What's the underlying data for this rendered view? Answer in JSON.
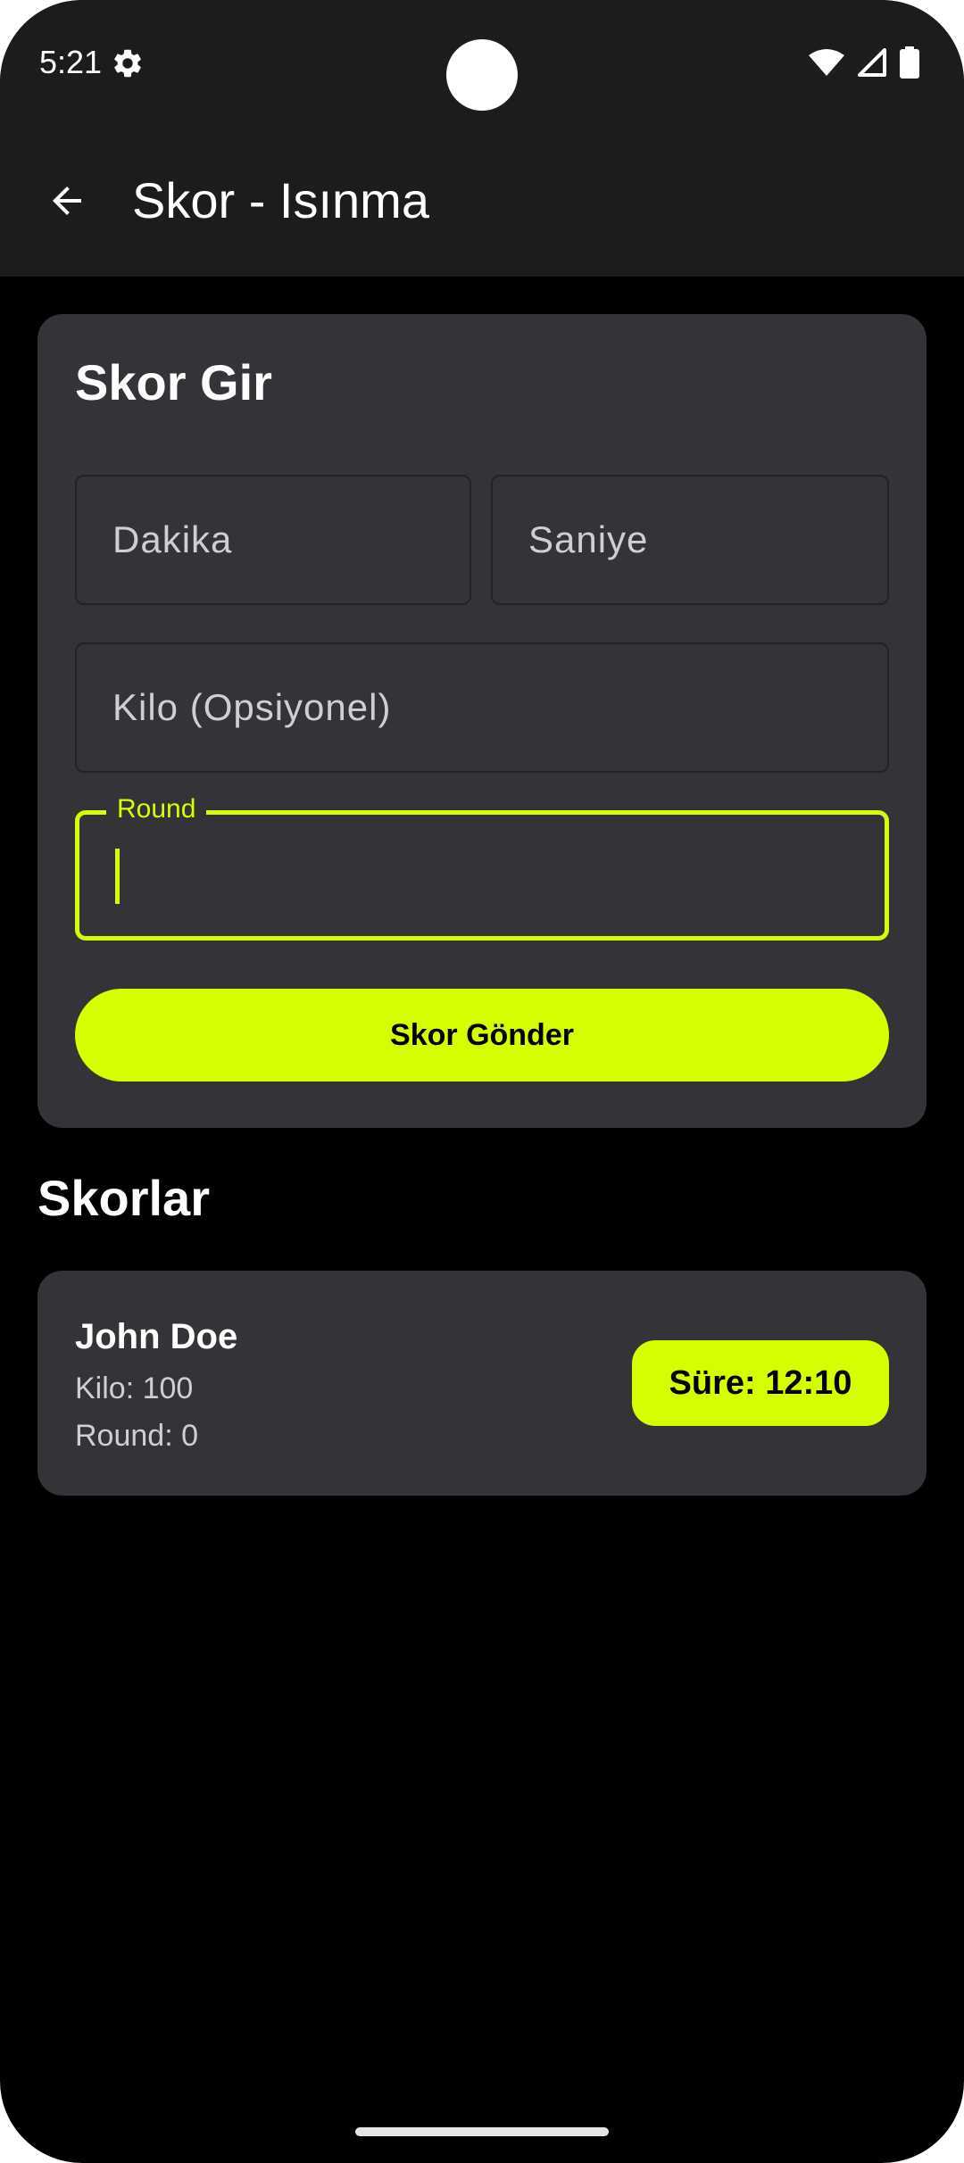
{
  "status_bar": {
    "time": "5:21",
    "icons": [
      "gear-icon",
      "wifi-icon",
      "signal-icon",
      "battery-icon"
    ]
  },
  "app_bar": {
    "title": "Skor - Isınma",
    "back_icon": "arrow-left-icon"
  },
  "entry_form": {
    "title": "Skor Gir",
    "minutes_placeholder": "Dakika",
    "seconds_placeholder": "Saniye",
    "weight_placeholder": "Kilo (Opsiyonel)",
    "round_label": "Round",
    "round_value": "",
    "submit_label": "Skor Gönder"
  },
  "scores": {
    "title": "Skorlar",
    "items": [
      {
        "name": "John Doe",
        "weight": "Kilo: 100",
        "round": "Round: 0",
        "time": "Süre: 12:10"
      }
    ]
  },
  "colors": {
    "accent": "#d4ff00",
    "background": "#000000",
    "surface": "#343438",
    "app_bar": "#1c1c1e"
  }
}
